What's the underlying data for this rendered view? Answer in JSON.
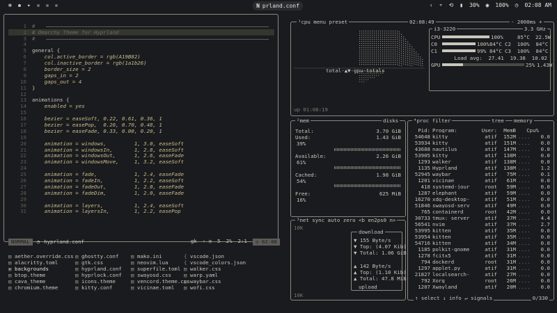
{
  "topbar": {
    "app_title": "prland.conf",
    "battery": "30%",
    "volume": "100%",
    "time": "02:08 AM"
  },
  "editor": {
    "lines": [
      {
        "n": "1",
        "t": "#",
        "cls": "comment"
      },
      {
        "n": "2",
        "t": "# Omarchy Theme for Hyprland",
        "cls": "comment",
        "hl": true
      },
      {
        "n": "3",
        "t": "#",
        "cls": "comment"
      },
      {
        "n": "4",
        "t": "",
        "cls": ""
      },
      {
        "n": "5",
        "t": "general {",
        "cls": ""
      },
      {
        "n": "6",
        "t": "    col.active_border = rgb(A19B82)",
        "cls": "italic"
      },
      {
        "n": "7",
        "t": "    col.inactive_border = rgb(1a1b26)",
        "cls": "italic"
      },
      {
        "n": "8",
        "t": "    border_size = 2",
        "cls": "italic"
      },
      {
        "n": "9",
        "t": "    gaps_in = 2",
        "cls": "italic"
      },
      {
        "n": "10",
        "t": "    gaps_out = 4",
        "cls": "italic"
      },
      {
        "n": "11",
        "t": "}",
        "cls": ""
      },
      {
        "n": "12",
        "t": "",
        "cls": ""
      },
      {
        "n": "13",
        "t": "animations {",
        "cls": ""
      },
      {
        "n": "14",
        "t": "    enabled = yes",
        "cls": "italic"
      },
      {
        "n": "15",
        "t": "",
        "cls": ""
      },
      {
        "n": "16",
        "t": "    bezier = easeSoft, 0.22, 0.61, 0.36, 1",
        "cls": "italic"
      },
      {
        "n": "17",
        "t": "    bezier = easePop,  0.26, 0.70, 0.48, 1",
        "cls": "italic"
      },
      {
        "n": "18",
        "t": "    bezier = easeFade, 0.33, 0.00, 0.20, 1",
        "cls": "italic"
      },
      {
        "n": "19",
        "t": "",
        "cls": ""
      },
      {
        "n": "20",
        "t": "    animation = windows,         1, 3.0, easeSoft",
        "cls": "italic"
      },
      {
        "n": "21",
        "t": "    animation = windowsIn,       1, 2.8, easeSoft",
        "cls": "italic"
      },
      {
        "n": "22",
        "t": "    animation = windowsOut,      1, 2.6, easeFade",
        "cls": "italic"
      },
      {
        "n": "23",
        "t": "    animation = windowsMove,     1, 3.2, easeSoft",
        "cls": "italic"
      },
      {
        "n": "24",
        "t": "",
        "cls": ""
      },
      {
        "n": "25",
        "t": "    animation = fade,            1, 2.4, easeFade",
        "cls": "italic"
      },
      {
        "n": "26",
        "t": "    animation = fadeIn,          1, 2.2, easeSoft",
        "cls": "italic"
      },
      {
        "n": "27",
        "t": "    animation = fadeOut,         1, 2.0, easeFade",
        "cls": "italic"
      },
      {
        "n": "28",
        "t": "    animation = fadeDim,         1, 2.0, easeFade",
        "cls": "italic"
      },
      {
        "n": "29",
        "t": "",
        "cls": ""
      },
      {
        "n": "30",
        "t": "    animation = layers,          1, 2.4, easeSoft",
        "cls": "italic"
      },
      {
        "n": "31",
        "t": "    animation = layersIn,        1, 2.2, easePop",
        "cls": "italic"
      }
    ],
    "status": {
      "mode": "NORMAL",
      "file": "hyprland.conf",
      "gk": "gk",
      "pct": "2%",
      "pos": "2:1",
      "clock": "02:08",
      "count": "5"
    }
  },
  "files": {
    "col1": [
      "aether.override.css",
      "alacritty.toml",
      "backgrounds",
      "btop.theme",
      "cava_theme",
      "chromium.theme"
    ],
    "col2": [
      "ghostty.conf",
      "gtk.css",
      "hyprland.conf",
      "hyprlock.conf",
      "icons.theme",
      "kitty.conf"
    ],
    "col3": [
      "mako.ini",
      "neovim.lua",
      "superfile.toml",
      "swayosd.css",
      "vencord.theme.css",
      "vicinae.toml"
    ],
    "col4": [
      "vscode.json",
      "vscode_colors.json",
      "walker.css",
      "warp.yaml",
      "waybar.css",
      "wofi.css"
    ]
  },
  "cpu": {
    "tabs": "¹cpu menu preset",
    "clock": "02:08:49",
    "interval": "- 2000ms +",
    "graph_label": "total-▲▼-gpu-totals",
    "uptime": "up 01:08:19",
    "model": "i3-3220",
    "freq": "3.3 GHz",
    "cores": [
      {
        "name": "CPU",
        "pct": "100%",
        "frac": 1.0,
        "temp": "85°C",
        "extra": "22.5W"
      },
      {
        "name": "C0",
        "pct": "100%",
        "frac": 1.0,
        "temp": "84°C",
        "extra": "C2  100%  84°C"
      },
      {
        "name": "C1",
        "pct": "99%",
        "frac": 0.99,
        "temp": "84°C",
        "extra": "C3  100%  84°C"
      }
    ],
    "load": "Load avg:  27.41  19.38  10.02",
    "gpu": {
      "name": "GPU",
      "pct": "25%",
      "frac": 0.25,
      "watts": "1.43W"
    }
  },
  "mem": {
    "header": "²mem",
    "disks": "disks",
    "total_label": "Total:",
    "total": "3.70 GiB",
    "used_label": "Used:",
    "used": "1.43 GiB",
    "used_pct": "39%",
    "avail_label": "Available:",
    "avail": "2.26 GiB",
    "avail_pct": "61%",
    "cached_label": "Cached:",
    "cached": "1.98 GiB",
    "cached_pct": "54%",
    "free_label": "Free:",
    "free": "625 MiB",
    "free_pct": "16%"
  },
  "net": {
    "header": "³net sync auto zero <b en2ps0 n>",
    "scale_top": "10K",
    "scale_bottom": "10K",
    "download": "download",
    "dl_rate": "▼ 155 Byte/s",
    "dl_top": "▼ Top: (4.07 Kib)",
    "dl_total": "▼ Total: 1.06 GiB",
    "ul_rate": "▲ 142 Byte/s",
    "ul_top": "▲ Top: (1.10 Kib)",
    "ul_total": "▲ Total: 47.8 MiB",
    "upload": "upload"
  },
  "proc": {
    "header": "⁴proc filter",
    "tree": "tree",
    "memory": "memory",
    "cols": [
      "Pid:",
      "Program:",
      "User:",
      "MemB",
      "Cpu%"
    ],
    "rows": [
      [
        "54648",
        "kitty",
        "atif",
        "152M",
        "0.0"
      ],
      [
        "53934",
        "kitty",
        "atif",
        "151M",
        "0.0"
      ],
      [
        "43688",
        "nautilus",
        "atif",
        "147M",
        "0.0"
      ],
      [
        "53905",
        "kitty",
        "atif",
        "138M",
        "0.0"
      ],
      [
        "1293",
        "walker",
        "atif",
        "138M",
        "0.0"
      ],
      [
        "1135",
        "Hyprland",
        "atif",
        "138M",
        "1.2"
      ],
      [
        "52945",
        "waybar",
        "atif",
        "75M",
        "0.1"
      ],
      [
        "1201",
        "vicinae",
        "atif",
        "61M",
        "0.0"
      ],
      [
        "418",
        "systemd-jour",
        "root",
        "59M",
        "0.0"
      ],
      [
        "1287",
        "elephant",
        "atif",
        "59M",
        "0.0"
      ],
      [
        "16270",
        "xdg-desktop-",
        "atif",
        "51M",
        "0.0"
      ],
      [
        "51846",
        "swayosd-serv",
        "atif",
        "49M",
        "0.0"
      ],
      [
        "765",
        "containerd",
        "root",
        "42M",
        "0.0"
      ],
      [
        "30733",
        "tmux: server",
        "atif",
        "37M",
        "4.4"
      ],
      [
        "56541",
        "nvim",
        "atif",
        "37M",
        "2.7"
      ],
      [
        "53995",
        "kitten",
        "atif",
        "35M",
        "0.0"
      ],
      [
        "53954",
        "kitten",
        "atif",
        "35M",
        "0.0"
      ],
      [
        "54716",
        "kitten",
        "atif",
        "34M",
        "0.0"
      ],
      [
        "1185",
        "polkit-gnome",
        "atif",
        "31M",
        "0.0"
      ],
      [
        "1278",
        "fcitx5",
        "atif",
        "31M",
        "0.0"
      ],
      [
        "794",
        "dockerd",
        "root",
        "31M",
        "0.0"
      ],
      [
        "1297",
        "applet.py",
        "atif",
        "31M",
        "0.0"
      ],
      [
        "21827",
        "localsearch-",
        "atif",
        "27M",
        "0.0"
      ],
      [
        "792",
        "Xorg",
        "root",
        "26M",
        "0.0"
      ],
      [
        "1207",
        "Xwayland",
        "atif",
        "20M",
        "0.0"
      ]
    ],
    "footer_left": "↑ select ↓ info ↵ signals",
    "footer_right": "0/330"
  }
}
